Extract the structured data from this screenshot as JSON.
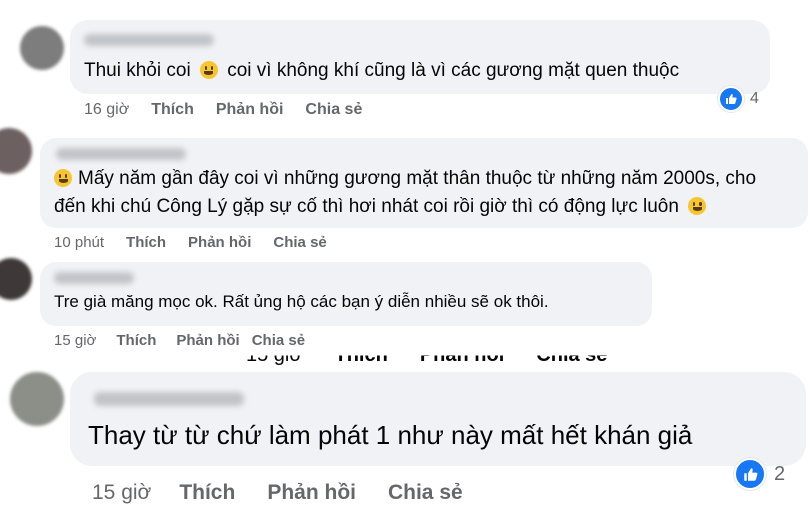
{
  "comments": [
    {
      "text": "Thui khỏi coi",
      "text_after_emoji": "coi vì không khí cũng là vì các gương mặt quen thuộc",
      "time": "16 giờ",
      "like": "Thích",
      "reply": "Phản hồi",
      "share": "Chia sẻ",
      "reaction_count": "4"
    },
    {
      "line1": "Mấy năm gần đây coi vì những gương mặt thân thuộc từ những năm 2000s, cho",
      "line2": "đến khi chú Công Lý gặp sự cố thì hơi nhát coi rồi giờ thì có động lực luôn",
      "time": "10 phút",
      "like": "Thích",
      "reply": "Phản hồi",
      "share": "Chia sẻ"
    },
    {
      "text": "Tre già măng mọc ok. Rất ủng hộ các bạn ý diễn nhiều sẽ ok thôi.",
      "time": "15 giờ",
      "like": "Thích",
      "reply": "Phản hồi",
      "share": "Chia sẻ"
    },
    {
      "text": "Thay từ từ chứ làm phát 1 như này mất hết khán giả",
      "time": "15 giờ",
      "like": "Thích",
      "reply": "Phản hồi",
      "share": "Chia sẻ",
      "reaction_count": "2"
    }
  ],
  "icons": {
    "reaction": "like-thumbs-up-icon",
    "emoji": "smiley-emoji-icon"
  },
  "colors": {
    "bubble": "#f0f2f5",
    "action_text": "#65676b",
    "like_blue": "#1877f2"
  }
}
